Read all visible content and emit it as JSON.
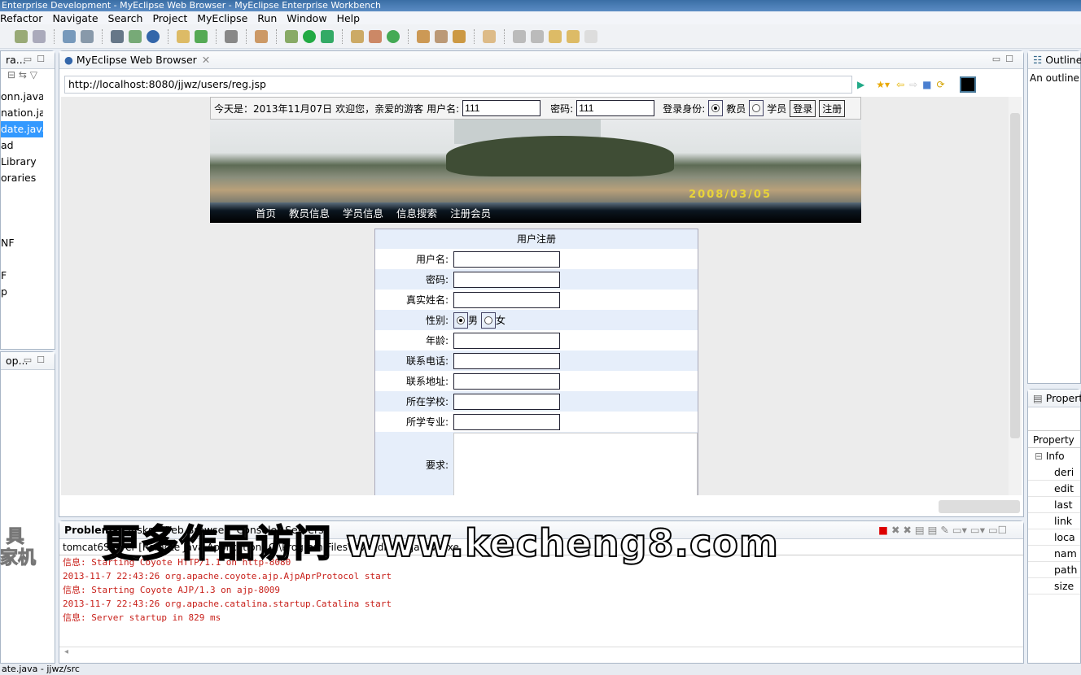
{
  "window": {
    "title": "Enterprise Development - MyEclipse Web Browser - MyEclipse Enterprise Workbench"
  },
  "menu": [
    "Refactor",
    "Navigate",
    "Search",
    "Project",
    "MyEclipse",
    "Run",
    "Window",
    "Help"
  ],
  "left_panel": {
    "tab": "ra...",
    "items": [
      "onn.java",
      "nation.java",
      "date.java",
      "ad",
      "Library",
      "oraries",
      "",
      "",
      "",
      "NF",
      "",
      "F",
      "p"
    ],
    "selected_index": 2
  },
  "left_panel2": {
    "tab": "op..."
  },
  "editor": {
    "tab": "MyEclipse Web Browser",
    "url": "http://localhost:8080/jjwz/users/reg.jsp"
  },
  "site": {
    "login": {
      "today": "今天是：2013年11月07日",
      "welcome": "欢迎您，亲爱的游客",
      "username_label": "用户名:",
      "username": "111",
      "password_label": "密码:",
      "password": "111",
      "role_label": "登录身份:",
      "role_teacher": "教员",
      "role_student": "学员",
      "role_selected": "教员",
      "login_button": "登录",
      "register_button": "注册"
    },
    "banner_date": "2008/03/05",
    "nav": [
      "首页",
      "教员信息",
      "学员信息",
      "信息搜索",
      "注册会员"
    ],
    "form": {
      "title": "用户注册",
      "fields": [
        "用户名:",
        "密码:",
        "真实姓名:"
      ],
      "gender_label": "性别:",
      "gender_male": "男",
      "gender_female": "女",
      "gender_selected": "男",
      "fields2": [
        "年龄:",
        "联系电话:",
        "联系地址:",
        "所在学校:",
        "所学专业:"
      ],
      "requirements_label": "要求:"
    }
  },
  "outline": {
    "tab": "Outline",
    "message": "An outline i"
  },
  "properties": {
    "tab": "Propert",
    "column": "Property",
    "group": "Info",
    "rows": [
      "deri",
      "edit",
      "last",
      "link",
      "loca",
      "nam",
      "path",
      "size"
    ]
  },
  "console": {
    "tabs": [
      "Problems",
      "Tasks",
      "Web Browser",
      "Console",
      "Servers"
    ],
    "header": "tomcat6Server [Remote Java Application] C:\\Program Files\\Java\\jdk\\bin\\javaw.exe",
    "lines": [
      "信息: Starting Coyote HTTP/1.1 on http-8080",
      "2013-11-7 22:43:26 org.apache.coyote.ajp.AjpAprProtocol start",
      "信息: Starting Coyote AJP/1.3 on ajp-8009",
      "2013-11-7 22:43:26 org.apache.catalina.startup.Catalina start",
      "信息: Server startup in 829 ms"
    ]
  },
  "status": "ate.java - jjwz/src",
  "watermark": "更多作品访问 www.kecheng8.com",
  "watermark_logo": "具 机"
}
